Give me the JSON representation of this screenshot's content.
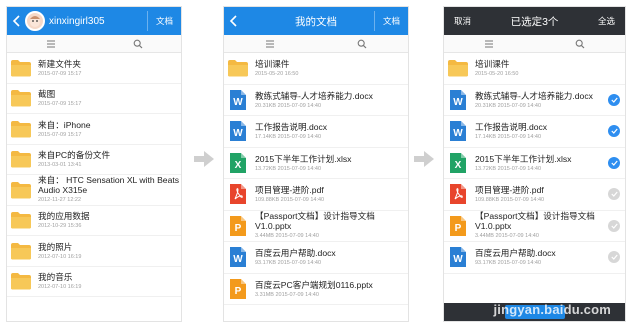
{
  "colors": {
    "blue": "#1e88e5",
    "dark": "#2e3136",
    "folder": "#f4b942",
    "word": "#2a7fd4",
    "excel": "#21a366",
    "pdf": "#e8452c",
    "pptx": "#f39a1c",
    "check": "#2e8ef0"
  },
  "screen1": {
    "username": "xinxingirl305",
    "doc_button": "文档",
    "toolbar": {
      "left_icon": "list-icon",
      "right_icon": "search-icon"
    },
    "rows": [
      {
        "type": "folder",
        "name": "新建文件夹",
        "date": "2015-07-09  15:17"
      },
      {
        "type": "folder",
        "name": "截图",
        "date": "2015-07-09  15:17"
      },
      {
        "type": "folder",
        "name": "来自：iPhone",
        "date": "2015-07-09  15:17"
      },
      {
        "type": "folder",
        "name": "来自PC的备份文件",
        "date": "2013-03-01  13:41"
      },
      {
        "type": "folder",
        "name": "来自： HTC Sensation XL with Beats Audio X315e",
        "date": "2012-11-27  12:22"
      },
      {
        "type": "folder",
        "name": "我的应用数据",
        "date": "2012-10-29  15:36"
      },
      {
        "type": "folder",
        "name": "我的照片",
        "date": "2012-07-10  16:19"
      },
      {
        "type": "folder",
        "name": "我的音乐",
        "date": "2012-07-10  16:19"
      }
    ]
  },
  "screen2": {
    "title": "我的文档",
    "doc_button": "文档",
    "rows": [
      {
        "type": "folder",
        "name": "培训课件",
        "date": "2015-05-20  16:50"
      },
      {
        "type": "word",
        "name": "教练式辅导-人才培养能力.docx",
        "date": "20.31KB  2015-07-09  14:40"
      },
      {
        "type": "word",
        "name": "工作报告说明.docx",
        "date": "17.14KB  2015-07-09  14:40"
      },
      {
        "type": "excel",
        "name": "2015下半年工作计划.xlsx",
        "date": "13.72KB  2015-07-09  14:40"
      },
      {
        "type": "pdf",
        "name": "项目管理-进阶.pdf",
        "date": "109.88KB  2015-07-09  14:40"
      },
      {
        "type": "pptx",
        "name": "【Passport文档】设计指导文档V1.0.pptx",
        "date": "3.44MB  2015-07-09  14:40"
      },
      {
        "type": "word",
        "name": "百度云用户帮助.docx",
        "date": "93.17KB  2015-07-09  14:40"
      },
      {
        "type": "pptx",
        "name": "百度云PC客户端规划0116.pptx",
        "date": "3.31MB  2015-07-09  14:40"
      }
    ]
  },
  "screen3": {
    "cancel": "取消",
    "title": "已选定3个",
    "select_all": "全选",
    "rows": [
      {
        "type": "folder",
        "name": "培训课件",
        "date": "2015-05-20  16:50",
        "checked": "none"
      },
      {
        "type": "word",
        "name": "教练式辅导-人才培养能力.docx",
        "date": "20.31KB  2015-07-09  14:40",
        "checked": "on"
      },
      {
        "type": "word",
        "name": "工作报告说明.docx",
        "date": "17.14KB  2015-07-09  14:40",
        "checked": "on"
      },
      {
        "type": "excel",
        "name": "2015下半年工作计划.xlsx",
        "date": "13.72KB  2015-07-09  14:40",
        "checked": "on"
      },
      {
        "type": "pdf",
        "name": "项目管理-进阶.pdf",
        "date": "109.88KB  2015-07-09  14:40",
        "checked": "off"
      },
      {
        "type": "pptx",
        "name": "【Passport文档】设计指导文档V1.0.pptx",
        "date": "3.44MB  2015-07-09  14:40",
        "checked": "off"
      },
      {
        "type": "word",
        "name": "百度云用户帮助.docx",
        "date": "93.17KB  2015-07-09  14:40",
        "checked": "off"
      }
    ]
  },
  "watermark": "jingyan.baidu.com"
}
